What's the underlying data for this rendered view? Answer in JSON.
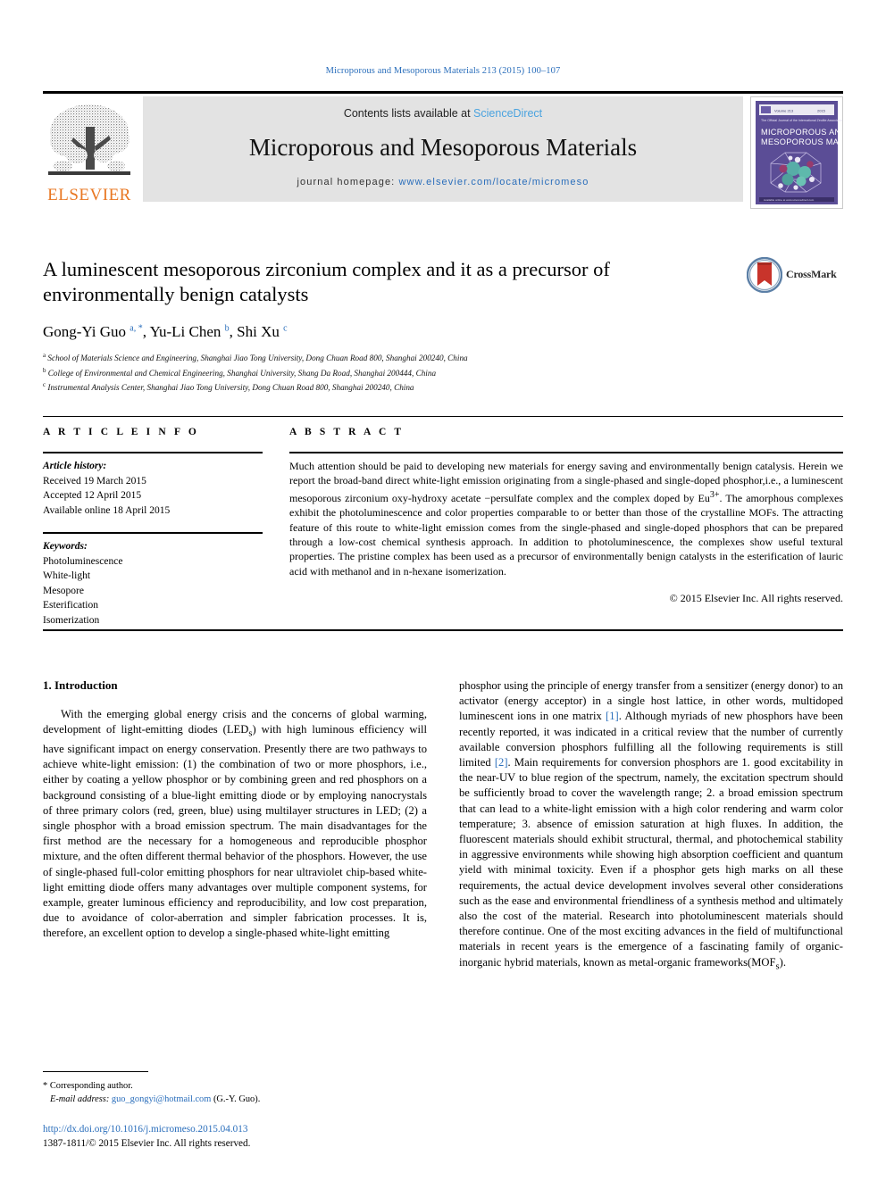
{
  "running_head": "Microporous and Mesoporous Materials 213 (2015) 100–107",
  "masthead": {
    "publisher_name": "ELSEVIER",
    "contents_prefix": "Contents lists available at ",
    "contents_link": "ScienceDirect",
    "journal_title": "Microporous and Mesoporous Materials",
    "homepage_prefix": "journal homepage: ",
    "homepage_url": "www.elsevier.com/locate/micromeso",
    "cover_title_line1": "MICROPOROUS AND",
    "cover_title_line2": "MESOPOROUS MATERIALS",
    "cover_bg": "#5b4d96"
  },
  "article": {
    "title": "A luminescent mesoporous zirconium complex and it as a precursor of environmentally benign catalysts",
    "crossmark_label": "CrossMark",
    "authors_html": "Gong-Yi Guo <sup>a, *</sup>, Yu-Li Chen <sup>b</sup>, Shi Xu <sup>c</sup>",
    "affiliations": [
      {
        "marker": "a",
        "text": "School of Materials Science and Engineering, Shanghai Jiao Tong University, Dong Chuan Road 800, Shanghai 200240, China"
      },
      {
        "marker": "b",
        "text": "College of Environmental and Chemical Engineering, Shanghai University, Shang Da Road, Shanghai 200444, China"
      },
      {
        "marker": "c",
        "text": "Instrumental Analysis Center, Shanghai Jiao Tong University, Dong Chuan Road 800, Shanghai 200240, China"
      }
    ]
  },
  "article_info": {
    "heading": "A R T I C L E   I N F O",
    "history_label": "Article history:",
    "history": [
      "Received 19 March 2015",
      "Accepted 12 April 2015",
      "Available online 18 April 2015"
    ],
    "keywords_label": "Keywords:",
    "keywords": [
      "Photoluminescence",
      "White-light",
      "Mesopore",
      "Esterification",
      "Isomerization"
    ]
  },
  "abstract": {
    "heading": "A B S T R A C T",
    "body_html": "Much attention should be paid to developing new materials for energy saving and environmentally benign catalysis. Herein we report the broad-band direct white-light emission originating from a single-phased and single-doped phosphor,i.e., a luminescent mesoporous zirconium oxy-hydroxy acetate −persulfate complex and the complex doped by Eu<sup>3+</sup>. The amorphous complexes exhibit the photoluminescence and color properties comparable to or better than those of the crystalline MOFs. The attracting feature of this route to white-light emission comes from the single-phased and single-doped phosphors that can be prepared through a low-cost chemical synthesis approach. In addition to photoluminescence, the complexes show useful textural properties. The pristine complex has been used as a precursor of environmentally benign catalysts in the esterification of lauric acid with methanol and in n-hexane isomerization.",
    "copyright": "© 2015 Elsevier Inc. All rights reserved."
  },
  "body": {
    "section_heading": "1. Introduction",
    "left_paragraph_html": "With the emerging global energy crisis and the concerns of global warming, development of light-emitting diodes (LED<sub>s</sub>) with high luminous efficiency will have significant impact on energy conservation. Presently there are two pathways to achieve white-light emission: (1) the combination of two or more phosphors, i.e., either by coating a yellow phosphor or by combining green and red phosphors on a background consisting of a blue-light emitting diode or by employing nanocrystals of three primary colors (red, green, blue) using multilayer structures in LED; (2) a single phosphor with a broad emission spectrum. The main disadvantages for the first method are the necessary for a homogeneous and reproducible phosphor mixture, and the often different thermal behavior of the phosphors. However, the use of single-phased full-color emitting phosphors for near ultraviolet chip-based white-light emitting diode offers many advantages over multiple component systems, for example, greater luminous efficiency and reproducibility, and low cost preparation, due to avoidance of color-aberration and simpler fabrication processes. It is, therefore, an excellent option to develop a single-phased white-light emitting",
    "right_paragraph_html": "phosphor using the principle of energy transfer from a sensitizer (energy donor) to an activator (energy acceptor) in a single host lattice, in other words, multidoped luminescent ions in one matrix <span class=\"cite\">[1]</span>. Although myriads of new phosphors have been recently reported, it was indicated in a critical review that the number of currently available conversion phosphors fulfilling all the following requirements is still limited <span class=\"cite\">[2]</span>. Main requirements for conversion phosphors are 1. good excitability in the near-UV to blue region of the spectrum, namely, the excitation spectrum should be sufficiently broad to cover the wavelength range; 2. a broad emission spectrum that can lead to a white-light emission with a high color rendering and warm color temperature; 3. absence of emission saturation at high fluxes. In addition, the fluorescent materials should exhibit structural, thermal, and photochemical stability in aggressive environments while showing high absorption coefficient and quantum yield with minimal toxicity. Even if a phosphor gets high marks on all these requirements, the actual device development involves several other considerations such as the ease and environmental friendliness of a synthesis method and ultimately also the cost of the material. Research into photoluminescent materials should therefore continue. One of the most exciting advances in the field of multifunctional materials in recent years is the emergence of a fascinating family of organic-inorganic hybrid materials, known as metal-organic frameworks(MOF<sub>s</sub>)."
  },
  "footnote": {
    "corresponding_marker": "*",
    "corresponding_text": "Corresponding author.",
    "email_label": "E-mail address:",
    "email": "guo_gongyi@hotmail.com",
    "email_suffix": "(G.-Y. Guo)."
  },
  "footer": {
    "doi": "http://dx.doi.org/10.1016/j.micromeso.2015.04.013",
    "issn_line": "1387-1811/© 2015 Elsevier Inc. All rights reserved."
  },
  "colors": {
    "link_blue": "#2a6ebb",
    "science_direct_blue": "#4aa3df",
    "elsevier_orange": "#E87722",
    "cover_purple": "#5b4d96",
    "crossmark_red": "#c8342b"
  }
}
